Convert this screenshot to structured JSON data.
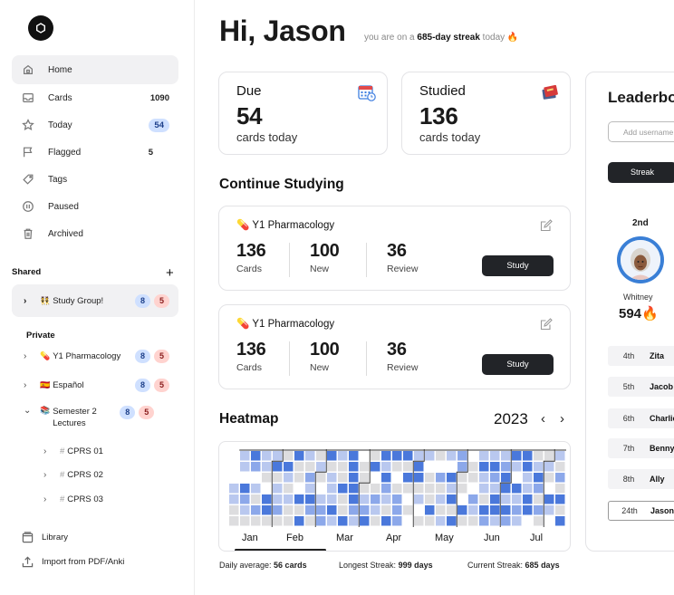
{
  "sidebar": {
    "nav": [
      {
        "label": "Home",
        "icon": "home-icon",
        "count": "",
        "pill": false
      },
      {
        "label": "Cards",
        "icon": "inbox-icon",
        "count": "1090",
        "pill": false
      },
      {
        "label": "Today",
        "icon": "star-icon",
        "count": "54",
        "pill": true
      },
      {
        "label": "Flagged",
        "icon": "flag-icon",
        "count": "5",
        "pill": false
      },
      {
        "label": "Tags",
        "icon": "tag-icon",
        "count": "",
        "pill": false
      },
      {
        "label": "Paused",
        "icon": "pause-icon",
        "count": "",
        "pill": false
      },
      {
        "label": "Archived",
        "icon": "trash-icon",
        "count": "",
        "pill": false
      }
    ],
    "shared_title": "Shared",
    "shared": [
      {
        "emoji": "👯",
        "label": "Study Group!",
        "blue": "8",
        "red": "5"
      }
    ],
    "private_title": "Private",
    "private": [
      {
        "emoji": "💊",
        "label": "Y1 Pharmacology",
        "blue": "8",
        "red": "5"
      },
      {
        "emoji": "🇪🇸",
        "label": "Español",
        "blue": "8",
        "red": "5"
      },
      {
        "emoji": "📚",
        "label": "Semester 2 Lectures",
        "blue": "8",
        "red": "5"
      }
    ],
    "subdecks": [
      "CPRS 01",
      "CPRS 02",
      "CPRS 03"
    ],
    "footer": [
      {
        "label": "Library",
        "icon": "library-icon"
      },
      {
        "label": "Import from PDF/Anki",
        "icon": "upload-icon"
      }
    ]
  },
  "header": {
    "greeting": "Hi, Jason",
    "streak_pre": "you are on a",
    "streak_bold": "685-day streak",
    "streak_post": "today 🔥"
  },
  "stats": [
    {
      "title": "Due",
      "value": "54",
      "sub": "cards today",
      "icon": "calendar-icon"
    },
    {
      "title": "Studied",
      "value": "136",
      "sub": "cards today",
      "icon": "book-icon"
    }
  ],
  "continue": {
    "title": "Continue Studying",
    "cards": [
      {
        "emoji": "💊",
        "title": "Y1 Pharmacology",
        "cards": "136",
        "cards_label": "Cards",
        "new": "100",
        "new_label": "New",
        "review": "36",
        "review_label": "Review",
        "button": "Study"
      },
      {
        "emoji": "💊",
        "title": "Y1 Pharmacology",
        "cards": "136",
        "cards_label": "Cards",
        "new": "100",
        "new_label": "New",
        "review": "36",
        "review_label": "Review",
        "button": "Study"
      }
    ]
  },
  "heatmap": {
    "title": "Heatmap",
    "year": "2023",
    "months": [
      "Jan",
      "Feb",
      "Mar",
      "Apr",
      "May",
      "Jun",
      "Jul"
    ],
    "daily_average_label": "Daily average:",
    "daily_average": "56 cards",
    "longest_label": "Longest Streak:",
    "longest": "999 days",
    "current_label": "Current Streak:",
    "current": "685 days",
    "colors": {
      "empty": "#ffffff",
      "l1": "#dddddf",
      "l2": "#b9c8ef",
      "l3": "#8ca8ea",
      "l4": "#4a78db"
    }
  },
  "leaderboard": {
    "title": "Leaderboard",
    "search_placeholder": "Add username",
    "tab": "Streak",
    "second_label": "2nd",
    "second_name": "Whitney",
    "second_score": "594🔥",
    "rows": [
      {
        "rank": "4th",
        "name": "Zita"
      },
      {
        "rank": "5th",
        "name": "Jacob"
      },
      {
        "rank": "6th",
        "name": "Charlie"
      },
      {
        "rank": "7th",
        "name": "Benny"
      },
      {
        "rank": "8th",
        "name": "Ally"
      },
      {
        "rank": "24th",
        "name": "Jason"
      }
    ]
  }
}
